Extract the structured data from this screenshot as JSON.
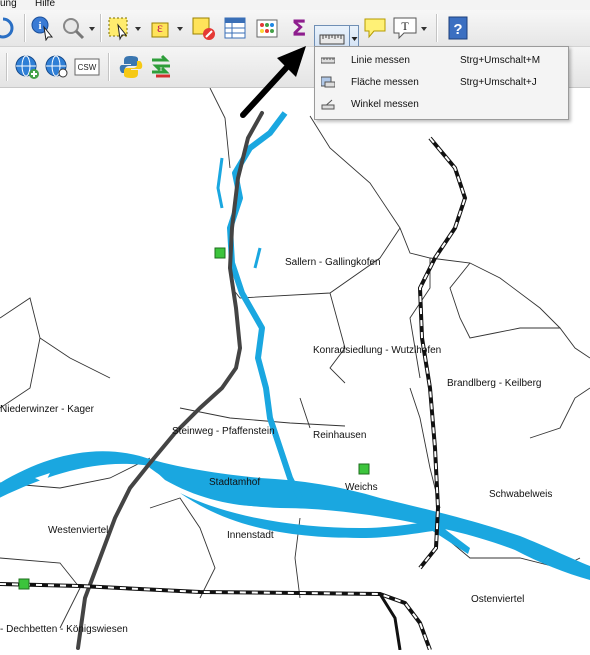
{
  "menubar": {
    "items": [
      "ung",
      "Hilfe"
    ]
  },
  "toolbar": {
    "csw_label": "CSW",
    "sum_glyph": "Σ",
    "help_glyph": "?",
    "text_glyph": "T"
  },
  "measure_menu": {
    "items": [
      {
        "label": "Linie messen",
        "shortcut": "Strg+Umschalt+M",
        "icon": "measure-line-icon"
      },
      {
        "label": "Fläche messen",
        "shortcut": "Strg+Umschalt+J",
        "icon": "measure-area-icon"
      },
      {
        "label": "Winkel messen",
        "shortcut": "",
        "icon": "measure-angle-icon"
      }
    ]
  },
  "map": {
    "labels": {
      "sallern": "Sallern - Gallingkofen",
      "konradsiedlung": "Konradsiedlung - Wutzlhofen",
      "brandlberg": "Brandlberg - Keilberg",
      "niederwinzer": "Niederwinzer - Kager",
      "steinweg": "Steinweg - Pfaffenstein",
      "reinhausen": "Reinhausen",
      "stadtamhof": "Stadtamhof",
      "weichs": "Weichs",
      "schwabelweis": "Schwabelweis",
      "westenviertel": "Westenviertel",
      "innenstadt": "Innenstadt",
      "ostenviertel": "Ostenviertel",
      "dechbetten": "- Dechbetten - Königswiesen"
    },
    "colors": {
      "river": "#1aa7e0",
      "road": "#444444",
      "rail": "#111111",
      "marker": "#3cc43c",
      "boundary": "#333333"
    }
  }
}
